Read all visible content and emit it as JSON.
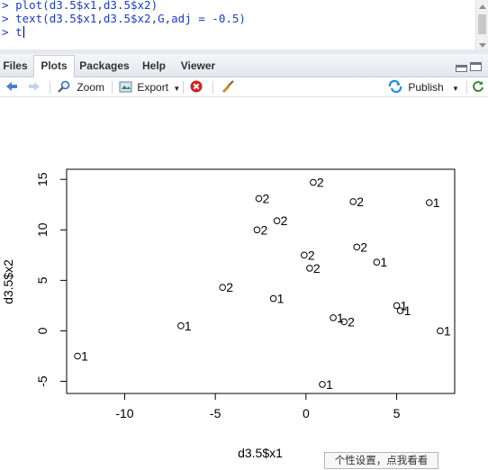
{
  "console": {
    "prompt": ">",
    "lines": [
      "plot(d3.5$x1,d3.5$x2)",
      "text(d3.5$x1,d3.5$x2,G,adj = -0.5)",
      "t"
    ]
  },
  "tabs": [
    "Files",
    "Plots",
    "Packages",
    "Help",
    "Viewer"
  ],
  "active_tab": "Plots",
  "toolbar": {
    "zoom_label": "Zoom",
    "export_label": "Export",
    "publish_label": "Publish"
  },
  "icons": [
    "back-arrow-icon",
    "forward-arrow-icon",
    "zoom-icon",
    "export-icon",
    "chevron-down-icon",
    "remove-plot-icon",
    "broom-icon",
    "publish-icon",
    "minimize-icon",
    "maximize-icon"
  ],
  "colors": {
    "console_text": "#1a3cc8",
    "back_arrow": "#4a7fd0",
    "publish": "#1f8fe0",
    "remove": "#d22222",
    "broom": "#c8902a"
  },
  "tooltip": "个性设置，点我看看",
  "chart_data": {
    "type": "scatter",
    "xlabel": "d3.5$x1",
    "ylabel": "d3.5$x2",
    "xlim": [
      -13.2,
      8.2
    ],
    "ylim": [
      -6.2,
      16
    ],
    "xticks": [
      "-10",
      "-5",
      "0",
      "5"
    ],
    "xtick_values": [
      -10,
      -5,
      0,
      5
    ],
    "yticks": [
      "-5",
      "0",
      "5",
      "10",
      "15"
    ],
    "ytick_values": [
      -5,
      0,
      5,
      10,
      15
    ],
    "points": [
      {
        "x": -12.6,
        "y": -2.5,
        "label": "1"
      },
      {
        "x": -6.9,
        "y": 0.5,
        "label": "1"
      },
      {
        "x": -4.6,
        "y": 4.3,
        "label": "2"
      },
      {
        "x": -2.6,
        "y": 13.1,
        "label": "2"
      },
      {
        "x": -2.7,
        "y": 10.0,
        "label": "2"
      },
      {
        "x": -1.6,
        "y": 10.9,
        "label": "2"
      },
      {
        "x": -1.8,
        "y": 3.2,
        "label": "1"
      },
      {
        "x": 0.4,
        "y": 14.7,
        "label": "2"
      },
      {
        "x": -0.1,
        "y": 7.5,
        "label": "2"
      },
      {
        "x": 0.2,
        "y": 6.2,
        "label": "2"
      },
      {
        "x": 0.9,
        "y": -5.3,
        "label": "1"
      },
      {
        "x": 1.5,
        "y": 1.3,
        "label": "1"
      },
      {
        "x": 2.1,
        "y": 0.9,
        "label": "2"
      },
      {
        "x": 2.6,
        "y": 12.8,
        "label": "2"
      },
      {
        "x": 2.8,
        "y": 8.3,
        "label": "2"
      },
      {
        "x": 3.9,
        "y": 6.8,
        "label": "1"
      },
      {
        "x": 5.0,
        "y": 2.5,
        "label": "1"
      },
      {
        "x": 5.2,
        "y": 2.0,
        "label": "1"
      },
      {
        "x": 6.8,
        "y": 12.7,
        "label": "1"
      },
      {
        "x": 7.4,
        "y": 0.0,
        "label": "1"
      }
    ]
  }
}
